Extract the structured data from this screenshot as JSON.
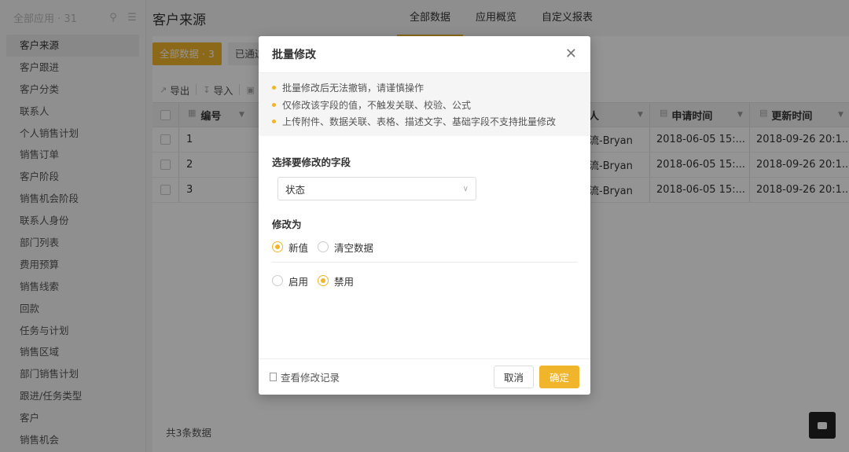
{
  "sidebar": {
    "title": "全部应用 · 31",
    "items": [
      "客户来源",
      "客户跟进",
      "客户分类",
      "联系人",
      "个人销售计划",
      "销售订单",
      "客户阶段",
      "销售机会阶段",
      "联系人身份",
      "部门列表",
      "费用预算",
      "销售线索",
      "回款",
      "任务与计划",
      "销售区域",
      "部门销售计划",
      "跟进/任务类型",
      "客户",
      "销售机会"
    ]
  },
  "header": {
    "title": "客户来源",
    "tabs": [
      "全部数据",
      "应用概览",
      "自定义报表"
    ]
  },
  "filters": {
    "all": "全部数据 · 3",
    "passed": "已通过"
  },
  "toolbar": {
    "export": "导出",
    "import": "导入"
  },
  "table": {
    "headers": {
      "id": "编号",
      "person": "人",
      "apply_time": "申请时间",
      "update_time": "更新时间"
    },
    "rows": [
      {
        "id": "1",
        "person": "流-Bryan",
        "apply": "2018-06-05 15:...",
        "update": "2018-09-26 20:1..."
      },
      {
        "id": "2",
        "person": "流-Bryan",
        "apply": "2018-06-05 15:...",
        "update": "2018-09-26 20:1..."
      },
      {
        "id": "3",
        "person": "流-Bryan",
        "apply": "2018-06-05 15:...",
        "update": "2018-09-26 20:1..."
      }
    ]
  },
  "footer": {
    "total": "共3条数据"
  },
  "modal": {
    "title": "批量修改",
    "notices": [
      "批量修改后无法撤销，请谨慎操作",
      "仅修改该字段的值，不触发关联、校验、公式",
      "上传附件、数据关联、表格、描述文字、基础字段不支持批量修改"
    ],
    "field_label": "选择要修改的字段",
    "field_value": "状态",
    "change_to_label": "修改为",
    "option_new": "新值",
    "option_clear": "清空数据",
    "value_enable": "启用",
    "value_disable": "禁用",
    "log_link": "查看修改记录",
    "cancel": "取消",
    "confirm": "确定"
  },
  "colors": {
    "accent": "#f0b52b"
  }
}
